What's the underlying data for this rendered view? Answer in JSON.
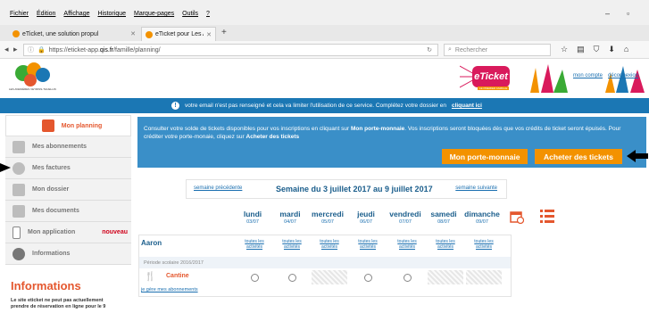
{
  "browser": {
    "menu": [
      "Fichier",
      "Édition",
      "Affichage",
      "Historique",
      "Marque-pages",
      "Outils",
      "?"
    ],
    "tabs": [
      {
        "label": "eTicket, une solution propul"
      },
      {
        "label": "eTicket pour Les Avenières"
      }
    ],
    "url_scheme_host": "https://eticket-app.",
    "url_domain": "qis.fr",
    "url_path": "/famille/planning/",
    "search_placeholder": "Rechercher"
  },
  "header": {
    "logo_caption": "LES AVENIÈRES VEYRINS-THUELLIN",
    "banner_title": "eTicket",
    "banner_sub": "LE PREMIER FAMILLE",
    "link_account": "mon compte",
    "link_logout": "déconnexion"
  },
  "notice": {
    "text": "votre email n'est pas renseigné et cela va limiter l'utilisation de ce service. Complétez votre dossier en",
    "link": "cliquant ici"
  },
  "sidebar": {
    "items": [
      {
        "label": "Mon planning"
      },
      {
        "label": "Mes abonnements"
      },
      {
        "label": "Mes factures"
      },
      {
        "label": "Mon dossier"
      },
      {
        "label": "Mes documents"
      },
      {
        "label": "Mon application"
      },
      {
        "label": "Informations"
      }
    ],
    "new_badge": "nouveau",
    "info_title": "Informations",
    "info_text_1": "Le site eticket ne peut pas actuellement",
    "info_text_2": "prendre de réservation en ligne pour le 9"
  },
  "panel": {
    "msg_a": "Consulter votre solde de tickets disponibles pour vos inscriptions en cliquant sur",
    "msg_b": "Mon porte-monnaie",
    "msg_c": ". Vos inscriptions seront bloquées dès que vos crédits de ticket seront épuisés. Pour créditer votre porte-monaie, cliquez sur",
    "msg_d": "Acheter des tickets",
    "btn_purse": "Mon porte-monnaie",
    "btn_buy": "Acheter des tickets"
  },
  "week": {
    "prev": "semaine précédente",
    "title": "Semaine du 3 juillet 2017 au 9 juillet 2017",
    "next": "semaine suivante",
    "days": [
      {
        "name": "lundi",
        "date": "03/07"
      },
      {
        "name": "mardi",
        "date": "04/07"
      },
      {
        "name": "mercredi",
        "date": "05/07"
      },
      {
        "name": "jeudi",
        "date": "06/07"
      },
      {
        "name": "vendredi",
        "date": "07/07"
      },
      {
        "name": "samedi",
        "date": "08/07"
      },
      {
        "name": "dimanche",
        "date": "09/07"
      }
    ]
  },
  "planning": {
    "child": "Aaron",
    "all_l1": "toutes les",
    "all_l2": "activités",
    "period": "Période scolaire 2016/2017",
    "activity": "Cantine",
    "cells": [
      "radio",
      "radio",
      "hatch",
      "radio",
      "radio",
      "hatch",
      "hatch"
    ],
    "manage_link": "je gère mes abonnements"
  }
}
